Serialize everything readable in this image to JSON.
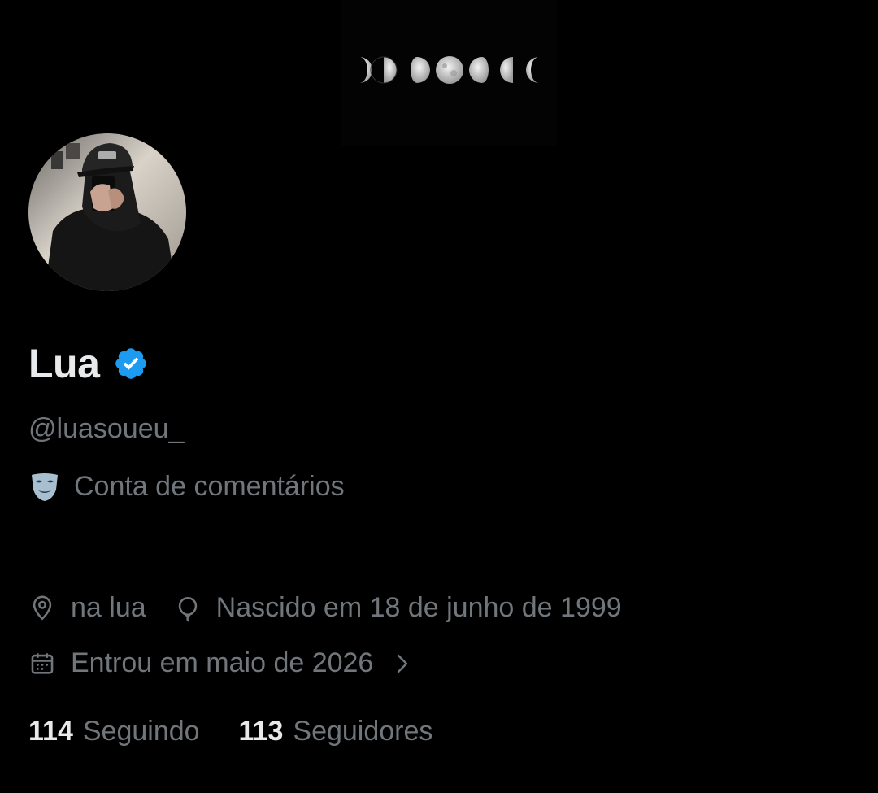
{
  "profile": {
    "name": "Lua",
    "handle": "@luasoueu_",
    "verified": true,
    "bio_emoji": "performing-arts-mask",
    "bio_text": "Conta de comentários",
    "location": "na lua",
    "birthday": "Nascido em 18 de junho de 1999",
    "joined": "Entrou em maio de 2026"
  },
  "stats": {
    "following_count": "114",
    "following_label": "Seguindo",
    "followers_count": "113",
    "followers_label": "Seguidores"
  },
  "colors": {
    "background": "#000000",
    "primary_text": "#e7e9ea",
    "secondary_text": "#71767b",
    "verified_badge": "#1d9bf0"
  },
  "icons": {
    "location": "location-pin-icon",
    "birthday": "balloon-icon",
    "joined": "calendar-icon",
    "joined_more": "chevron-right-icon",
    "verified": "verified-badge-icon"
  }
}
